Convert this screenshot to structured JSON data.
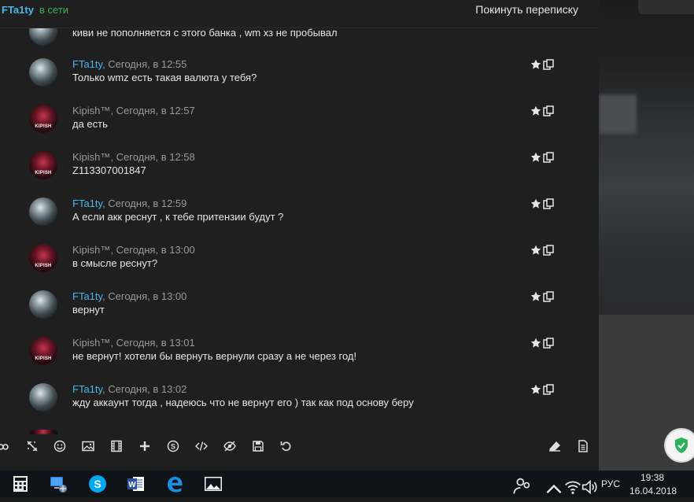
{
  "header": {
    "contact_name": "FTa1ty",
    "contact_status": "в сети",
    "leave_label": "Покинуть переписку"
  },
  "partial_top_message": "киви не пополняется с этого банка , wm хз не пробывал",
  "messages": [
    {
      "author": "FTa1ty",
      "time": ", Сегодня, в 12:55",
      "text": "Только wmz есть такая валюта у тебя?"
    },
    {
      "author": "Kipish™",
      "time": ", Сегодня, в 12:57",
      "text": "да есть"
    },
    {
      "author": "Kipish™",
      "time": ", Сегодня, в 12:58",
      "text": "Z113307001847"
    },
    {
      "author": "FTa1ty",
      "time": ", Сегодня, в 12:59",
      "text": "А если акк реснут , к тебе притензии будут ?"
    },
    {
      "author": "Kipish™",
      "time": ", Сегодня, в 13:00",
      "text": "в смысле реснут?"
    },
    {
      "author": "FTa1ty",
      "time": ", Сегодня, в 13:00",
      "text": "вернут"
    },
    {
      "author": "Kipish™",
      "time": ", Сегодня, в 13:01",
      "text": "не вернут! хотели бы вернуть вернули сразу а не через год!"
    },
    {
      "author": "FTa1ty",
      "time": ", Сегодня, в 13:02",
      "text": "жду аккаунт тогда , надеюсь что не вернут его ) так как под основу беру"
    }
  ],
  "avatar_caption": "KIPISH",
  "toolbar_icons": [
    "link-icon",
    "unlink-icon",
    "smiley-icon",
    "image-icon",
    "media-icon",
    "plus-icon",
    "skype-icon",
    "code-icon",
    "hide-icon",
    "save-icon",
    "undo-icon",
    "eraser-icon",
    "document-icon"
  ],
  "taskbar": {
    "apps": [
      "calculator-icon",
      "network-icon",
      "skype-icon",
      "word-icon",
      "edge-icon",
      "photos-icon"
    ],
    "language": "РУС",
    "time": "19:38",
    "date": "16.04.2018"
  },
  "colors": {
    "accent_blue": "#4cb7ea",
    "online_green": "#39b44a",
    "background": "#1f1f1f",
    "text": "#e5e5e5",
    "meta": "#9a9a9a"
  }
}
